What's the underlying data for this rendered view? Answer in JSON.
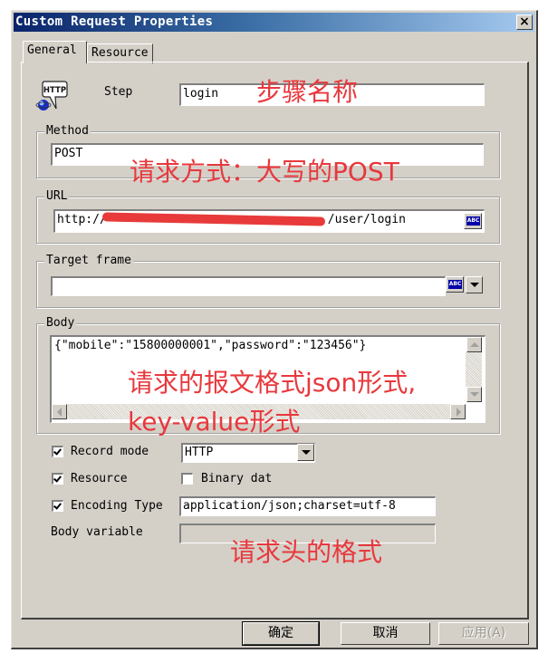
{
  "window": {
    "title": "Custom Request Properties",
    "close_label": "×"
  },
  "tabs": [
    {
      "label": "General",
      "active": true
    },
    {
      "label": "Resource",
      "active": false
    }
  ],
  "icons": {
    "http_icon_text": "HTTP",
    "abc_text": "ABC"
  },
  "step": {
    "label": "Step",
    "value": "login"
  },
  "method": {
    "group_label": "Method",
    "value": "POST"
  },
  "url": {
    "group_label": "URL",
    "value_prefix": "http://",
    "value_suffix": "/user/login"
  },
  "target_frame": {
    "group_label": "Target frame",
    "value": ""
  },
  "body": {
    "group_label": "Body",
    "value": "{\"mobile\":\"15800000001\",\"password\":\"123456\"}"
  },
  "options": {
    "record_mode": {
      "label": "Record mode",
      "checked": true,
      "value": "HTTP"
    },
    "resource": {
      "label": "Resource",
      "checked": true
    },
    "binary_data": {
      "label": "Binary dat",
      "checked": false
    },
    "encoding_type": {
      "label": "Encoding Type",
      "checked": true,
      "value": "application/json;charset=utf-8"
    },
    "body_variable": {
      "label": "Body variable",
      "value": ""
    }
  },
  "buttons": {
    "ok": "确定",
    "cancel": "取消",
    "apply": "应用(A)"
  },
  "annotations": {
    "step_name": "步骤名称",
    "method_note": "请求方式：大写的POST",
    "body_note_line1": "请求的报文格式json形式,",
    "body_note_line2": "key-value形式",
    "header_note": "请求头的格式"
  },
  "colors": {
    "annotation": "#e8383d",
    "titlebar_start": "#0a246a",
    "titlebar_end": "#a6caf0",
    "dialog_bg": "#d4d0c8"
  }
}
